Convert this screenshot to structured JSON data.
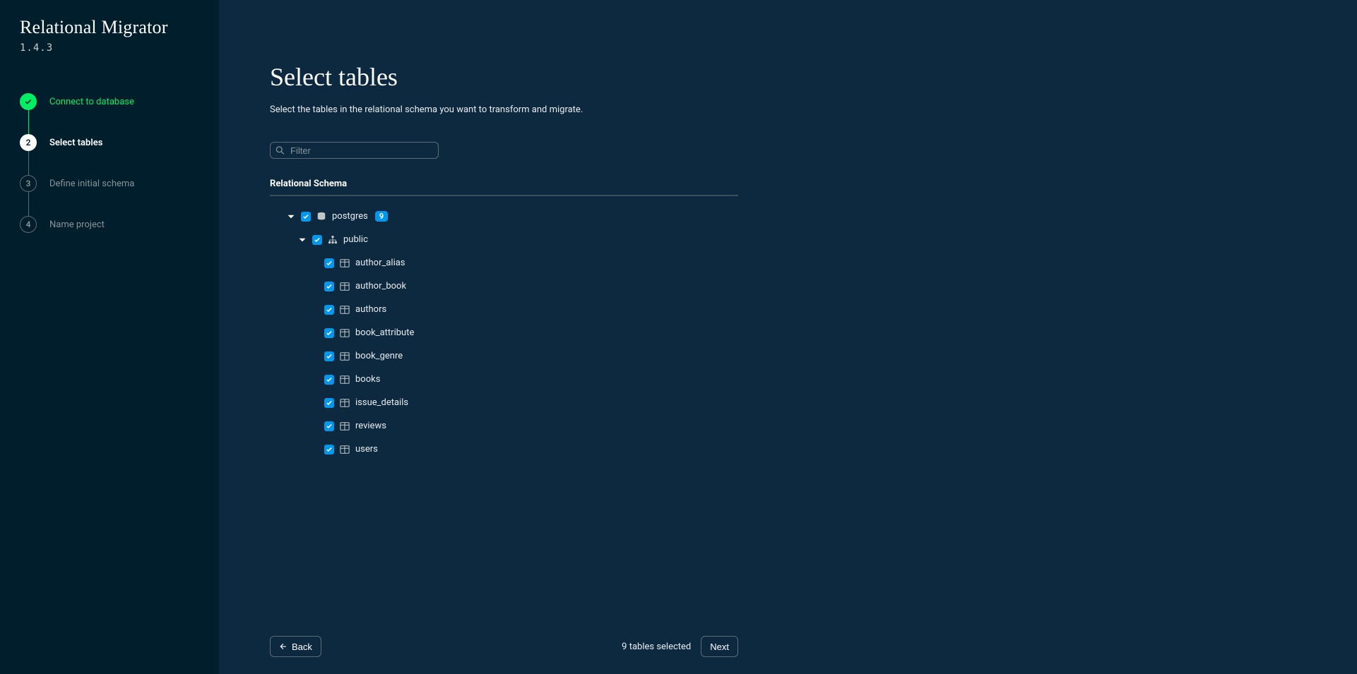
{
  "app": {
    "title": "Relational Migrator",
    "version": "1.4.3"
  },
  "steps": [
    {
      "label": "Connect to database",
      "state": "completed"
    },
    {
      "label": "Select tables",
      "state": "active",
      "num": "2"
    },
    {
      "label": "Define initial schema",
      "state": "pending",
      "num": "3"
    },
    {
      "label": "Name project",
      "state": "pending",
      "num": "4"
    }
  ],
  "main": {
    "title": "Select tables",
    "subtitle": "Select the tables in the relational schema you want to transform and migrate.",
    "filter_placeholder": "Filter",
    "schema_heading": "Relational Schema"
  },
  "tree": {
    "database": {
      "name": "postgres",
      "badge": "9"
    },
    "schema": {
      "name": "public"
    },
    "tables": [
      {
        "name": "author_alias"
      },
      {
        "name": "author_book"
      },
      {
        "name": "authors"
      },
      {
        "name": "book_attribute"
      },
      {
        "name": "book_genre"
      },
      {
        "name": "books"
      },
      {
        "name": "issue_details"
      },
      {
        "name": "reviews"
      },
      {
        "name": "users"
      }
    ]
  },
  "footer": {
    "back": "Back",
    "next": "Next",
    "selected_text": "9 tables selected"
  }
}
